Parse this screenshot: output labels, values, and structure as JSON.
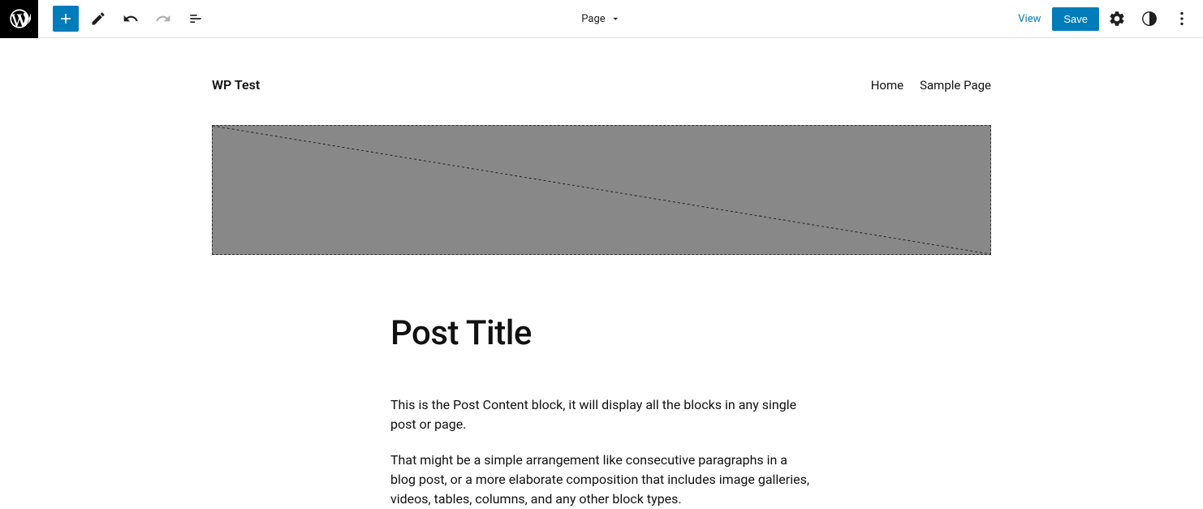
{
  "toolbar": {
    "center_label": "Page",
    "view_label": "View",
    "save_label": "Save"
  },
  "site": {
    "title": "WP Test",
    "nav": [
      "Home",
      "Sample Page"
    ]
  },
  "post": {
    "title": "Post Title",
    "paragraphs": [
      "This is the Post Content block, it will display all the blocks in any single post or page.",
      "That might be a simple arrangement like consecutive paragraphs in a blog post, or a more elaborate composition that includes image galleries, videos, tables, columns, and any other block types."
    ]
  }
}
